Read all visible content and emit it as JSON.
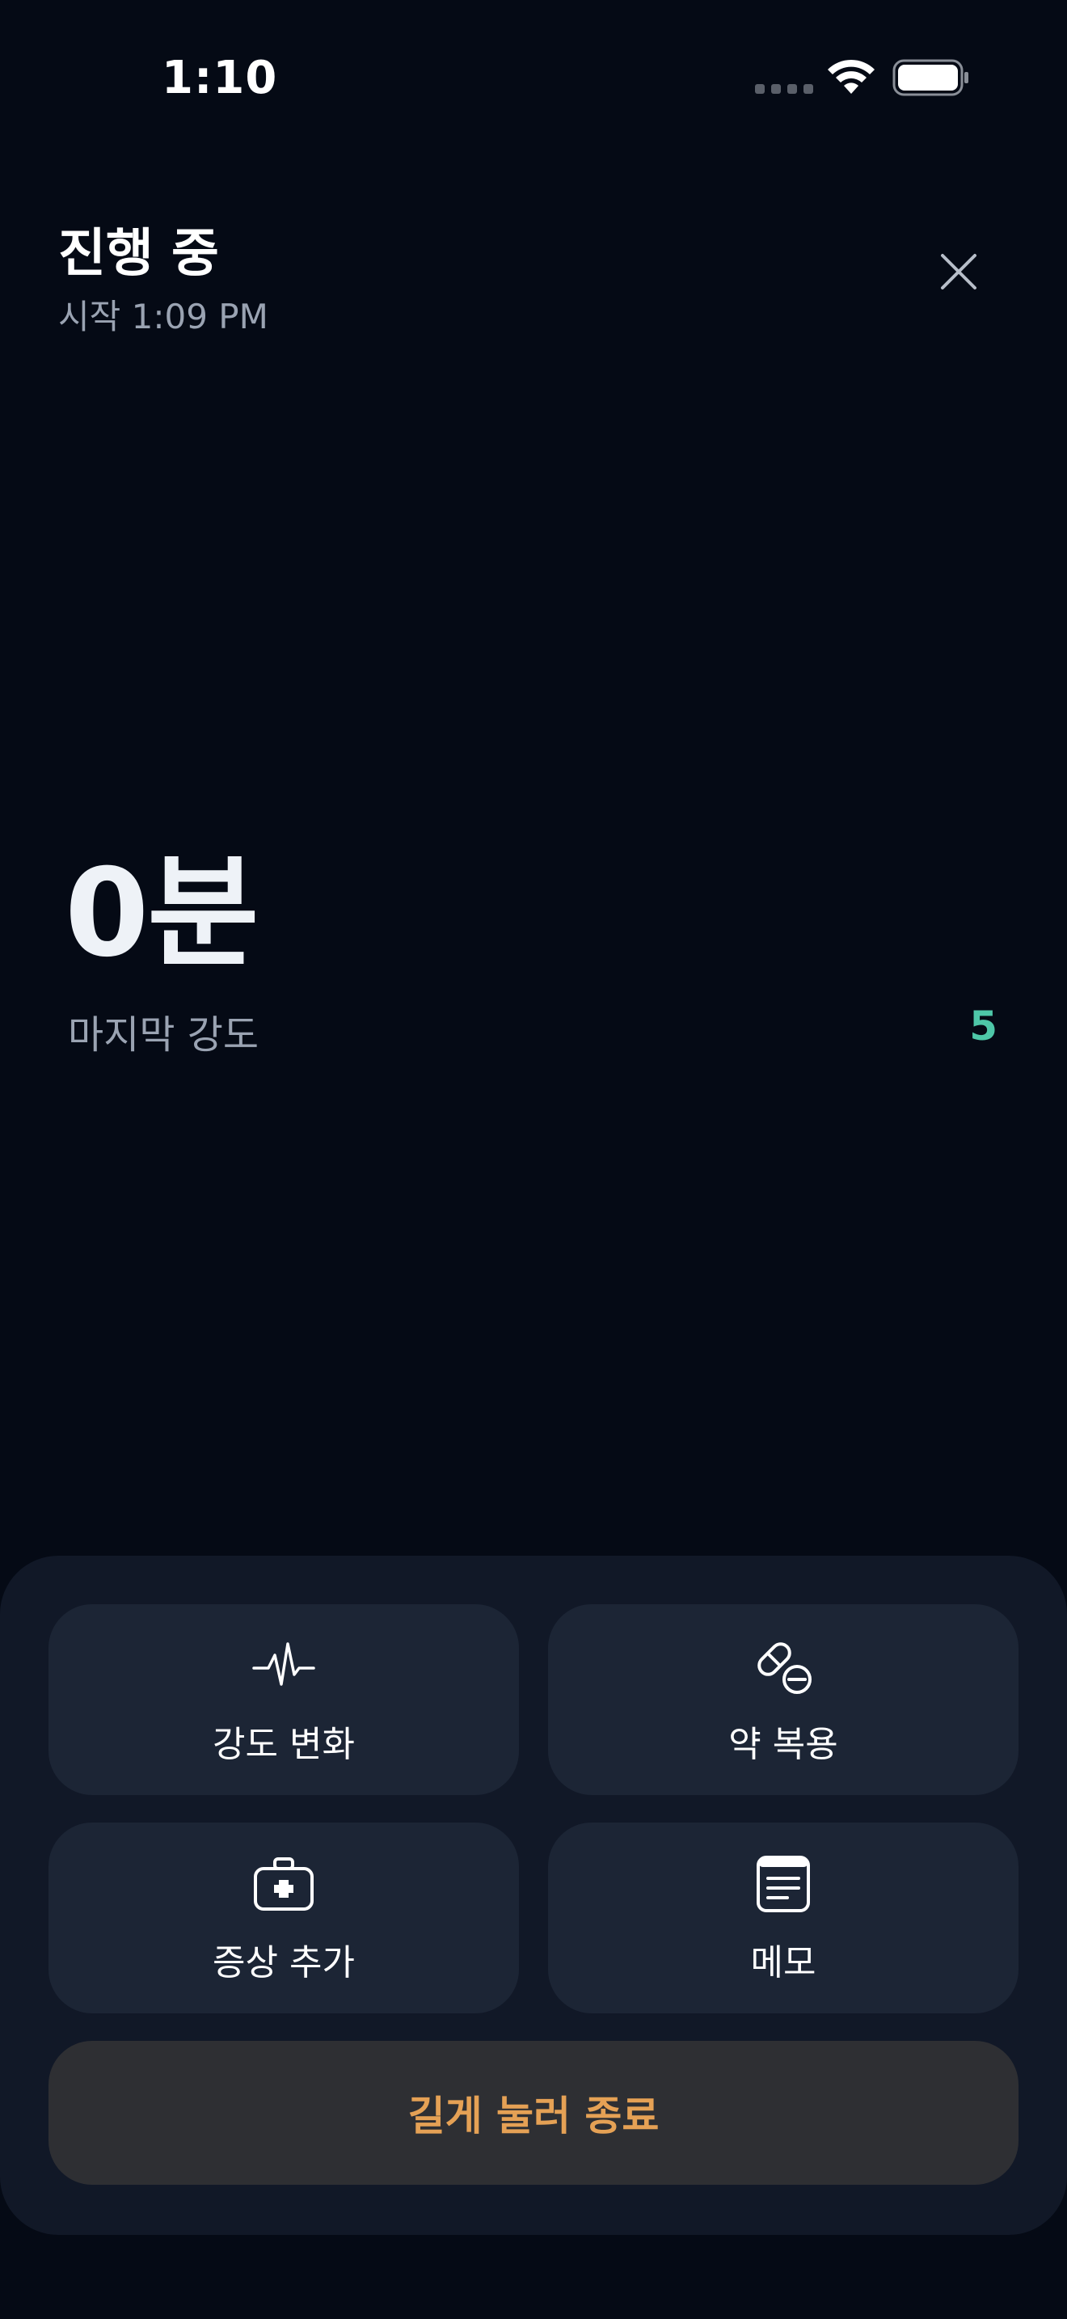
{
  "status_bar": {
    "time": "1:10"
  },
  "header": {
    "title": "진행 중",
    "start_time": "시작 1:09 PM"
  },
  "timer": {
    "elapsed": "0분",
    "last_intensity_label": "마지막 강도",
    "last_intensity_value": "5"
  },
  "actions": [
    {
      "label": "강도 변화",
      "icon": "heartbeat-icon"
    },
    {
      "label": "약 복용",
      "icon": "pill-icon"
    },
    {
      "label": "증상 추가",
      "icon": "first-aid-kit-icon"
    },
    {
      "label": "메모",
      "icon": "note-icon"
    }
  ],
  "end_button": {
    "label": "길게 눌러 종료"
  },
  "colors": {
    "background": "#050a15",
    "panel": "#111827",
    "card": "#1c2535",
    "accent_green": "#4ec7a8",
    "accent_orange": "#e5a155"
  }
}
